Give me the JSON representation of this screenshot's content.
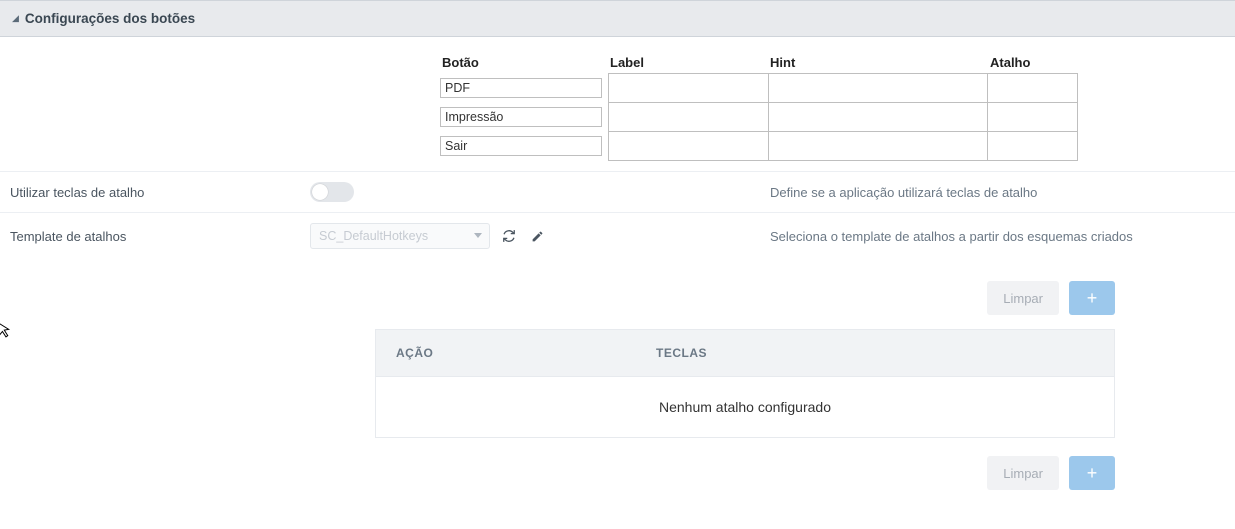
{
  "panel": {
    "title": "Configurações dos botões"
  },
  "table": {
    "headers": {
      "botao": "Botão",
      "label": "Label",
      "hint": "Hint",
      "atalho": "Atalho"
    },
    "rows": [
      {
        "botao": "PDF",
        "label": "",
        "hint": "",
        "atalho": ""
      },
      {
        "botao": "Impressão",
        "label": "",
        "hint": "",
        "atalho": ""
      },
      {
        "botao": "Sair",
        "label": "",
        "hint": "",
        "atalho": ""
      }
    ]
  },
  "settings": {
    "useHotkeys": {
      "label": "Utilizar teclas de atalho",
      "desc": "Define se a aplicação utilizará teclas de atalho"
    },
    "template": {
      "label": "Template de atalhos",
      "value": "SC_DefaultHotkeys",
      "desc": "Seleciona o template de atalhos a partir dos esquemas criados"
    }
  },
  "buttons": {
    "clear": "Limpar",
    "add": "+"
  },
  "shortcutTable": {
    "headers": {
      "acao": "AÇÃO",
      "teclas": "TECLAS"
    },
    "empty": "Nenhum atalho configurado"
  }
}
